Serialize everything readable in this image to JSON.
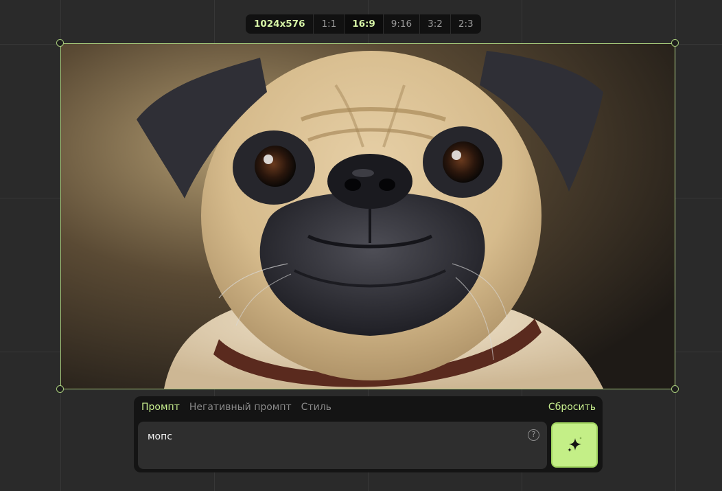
{
  "toolbar": {
    "size_label": "1024x576",
    "ratios": [
      {
        "label": "1:1",
        "active": false
      },
      {
        "label": "16:9",
        "active": true
      },
      {
        "label": "9:16",
        "active": false
      },
      {
        "label": "3:2",
        "active": false
      },
      {
        "label": "2:3",
        "active": false
      }
    ]
  },
  "canvas": {
    "image_icon": "pug-portrait-image",
    "frame_color": "#a9cd7c"
  },
  "prompt_panel": {
    "tabs": [
      {
        "label": "Промпт",
        "active": true
      },
      {
        "label": "Негативный промпт",
        "active": false
      },
      {
        "label": "Стиль",
        "active": false
      }
    ],
    "reset_label": "Сбросить",
    "prompt_value": "мопс",
    "help_icon": "question-circle-icon",
    "help_symbol": "?",
    "generate_icon": "sparkle-icon"
  },
  "colors": {
    "accent": "#c9f08f",
    "button_bg": "#c4ef87",
    "background": "#2a2a2a",
    "panel_bg": "#141414"
  }
}
